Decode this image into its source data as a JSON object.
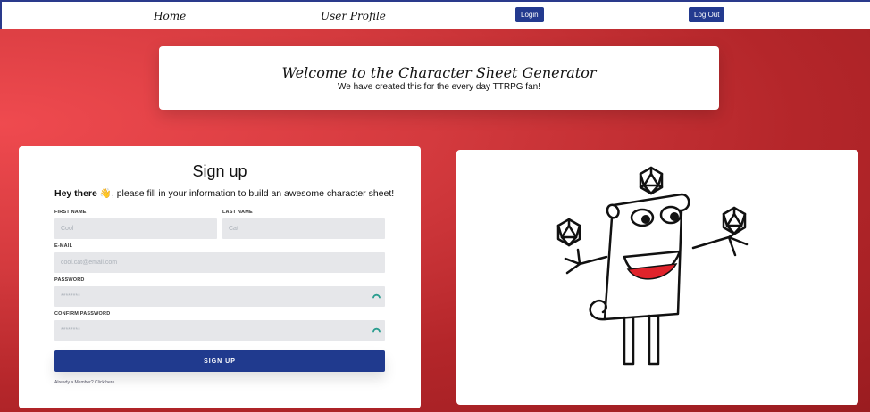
{
  "nav": {
    "home": "Home",
    "profile": "User Profile",
    "login": "Login",
    "logout": "Log Out"
  },
  "welcome": {
    "title": "Welcome to the Character Sheet Generator",
    "subtitle": "We have created this for the every day TTRPG fan!"
  },
  "signup": {
    "title": "Sign up",
    "intro_bold": "Hey there",
    "intro_emoji": "👋",
    "intro_rest": ", please fill in your information to build an awesome character sheet!",
    "first_name_label": "First Name",
    "first_name_placeholder": "Cool",
    "last_name_label": "Last Name",
    "last_name_placeholder": "Cat",
    "email_label": "E-mail",
    "email_placeholder": "cool.cat@email.com",
    "password_label": "Password",
    "password_value": "********",
    "confirm_label": "Confirm Password",
    "confirm_value": "********",
    "button": "SIGN UP",
    "member_link": "Already a Member? Click here"
  },
  "colors": {
    "accent": "#203a8e",
    "background_red": "#d43a3e",
    "eye_icon": "#2a9d8f"
  },
  "icons": {
    "password_toggle": "eye-icon",
    "mascot": "scroll-mascot-juggling-dice"
  }
}
